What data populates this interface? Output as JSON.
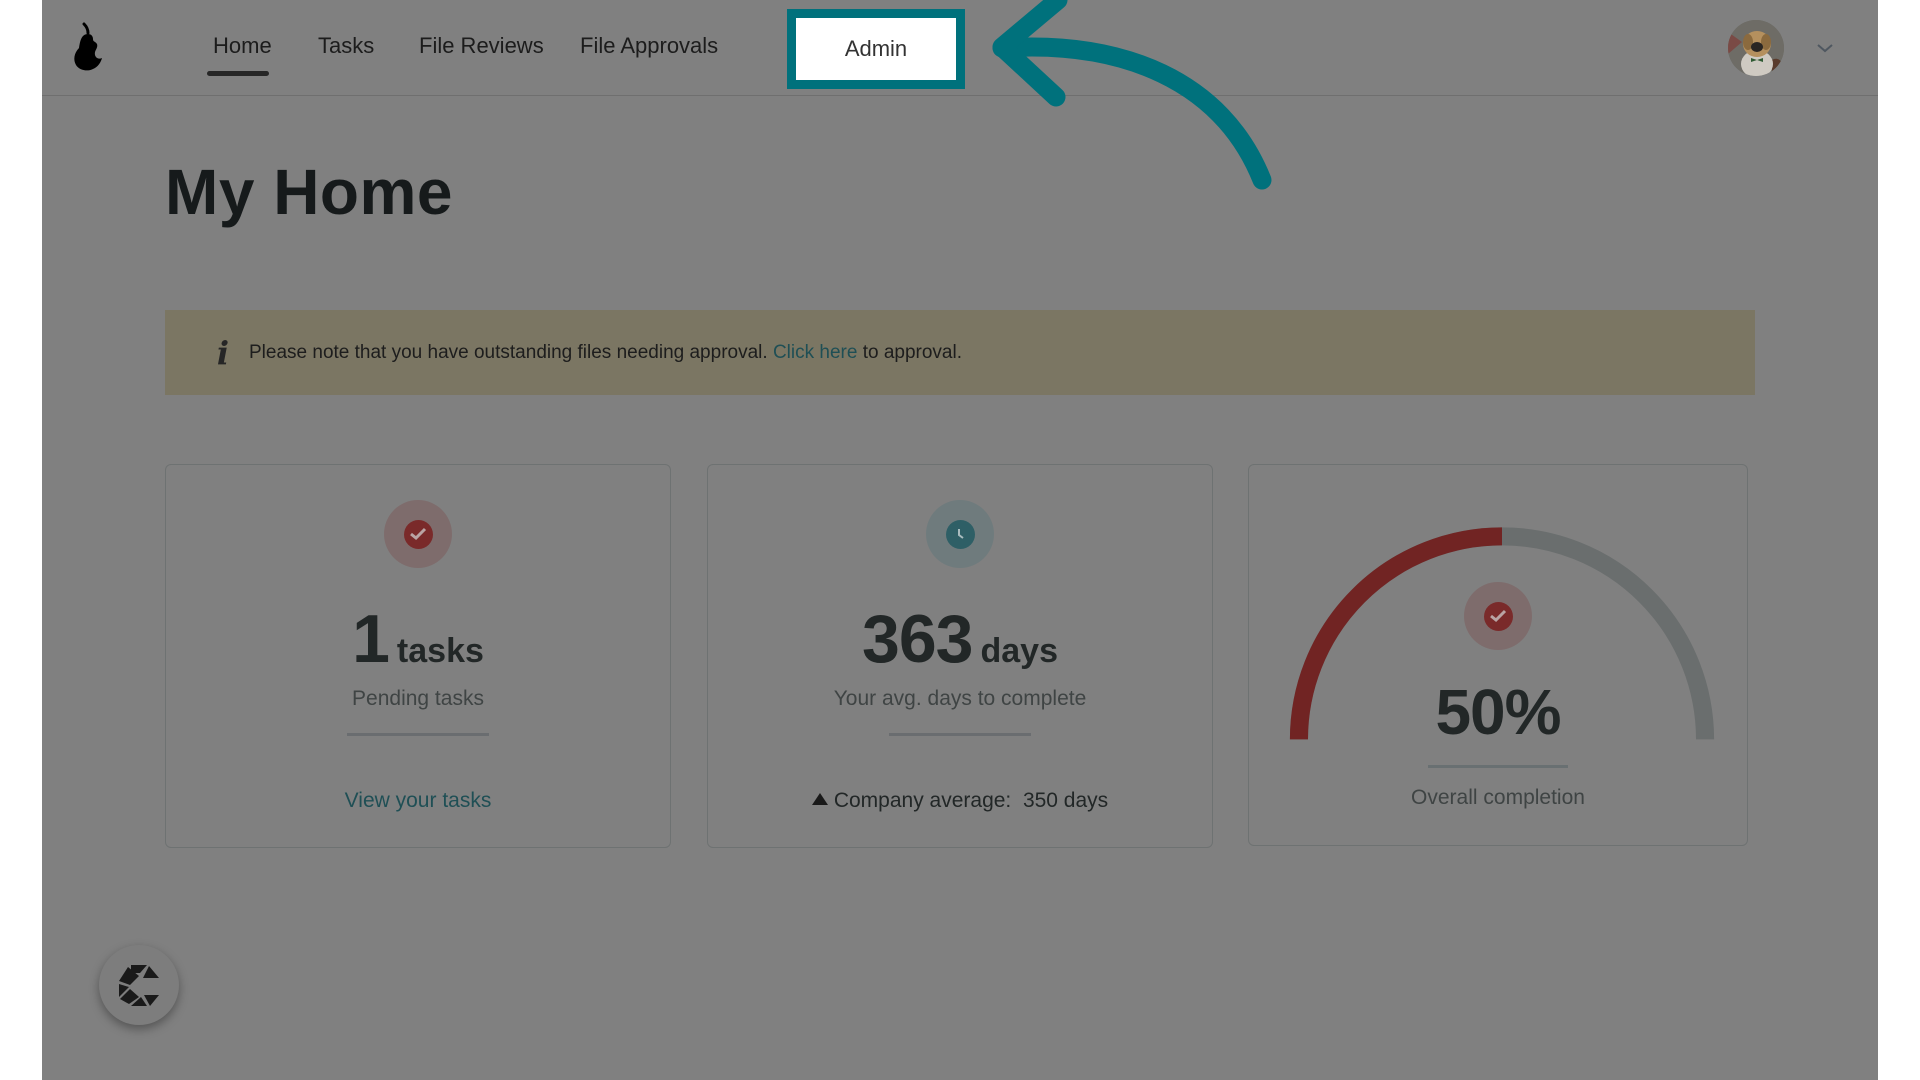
{
  "nav": {
    "items": [
      {
        "label": "Home",
        "active": true
      },
      {
        "label": "Tasks",
        "active": false
      },
      {
        "label": "File Reviews",
        "active": false
      },
      {
        "label": "File Approvals",
        "active": false
      }
    ],
    "highlighted": {
      "label": "Admin"
    },
    "logo_icon": "pear-logo-icon",
    "avatar_icon": "user-avatar-dog-photo",
    "menu_icon": "chevron-down-icon"
  },
  "annotation": {
    "arrow_icon": "curved-arrow-left-icon",
    "color": "#00717c"
  },
  "page": {
    "title": "My Home"
  },
  "banner": {
    "icon": "info-icon",
    "icon_glyph": "i",
    "text_before": "Please note that you have outstanding files needing approval.",
    "link_text": "Click here",
    "text_after": "to approval.",
    "background": "#7b7663"
  },
  "cards": {
    "tasks": {
      "icon": "check-circle-icon",
      "value": "1",
      "unit": "tasks",
      "label": "Pending tasks",
      "link": "View your tasks"
    },
    "days": {
      "icon": "clock-icon",
      "value": "363",
      "unit": "days",
      "label": "Your avg. days to complete",
      "comparison_icon": "triangle-up-icon",
      "comparison_label": "Company average:",
      "comparison_value": "350 days"
    },
    "completion": {
      "icon": "check-circle-icon",
      "value": "50%",
      "percent": 50,
      "label": "Overall completion",
      "fill_color": "#712423",
      "track_color": "#6a6e6e"
    }
  },
  "fab": {
    "icon": "chat-widget-logo-icon"
  }
}
